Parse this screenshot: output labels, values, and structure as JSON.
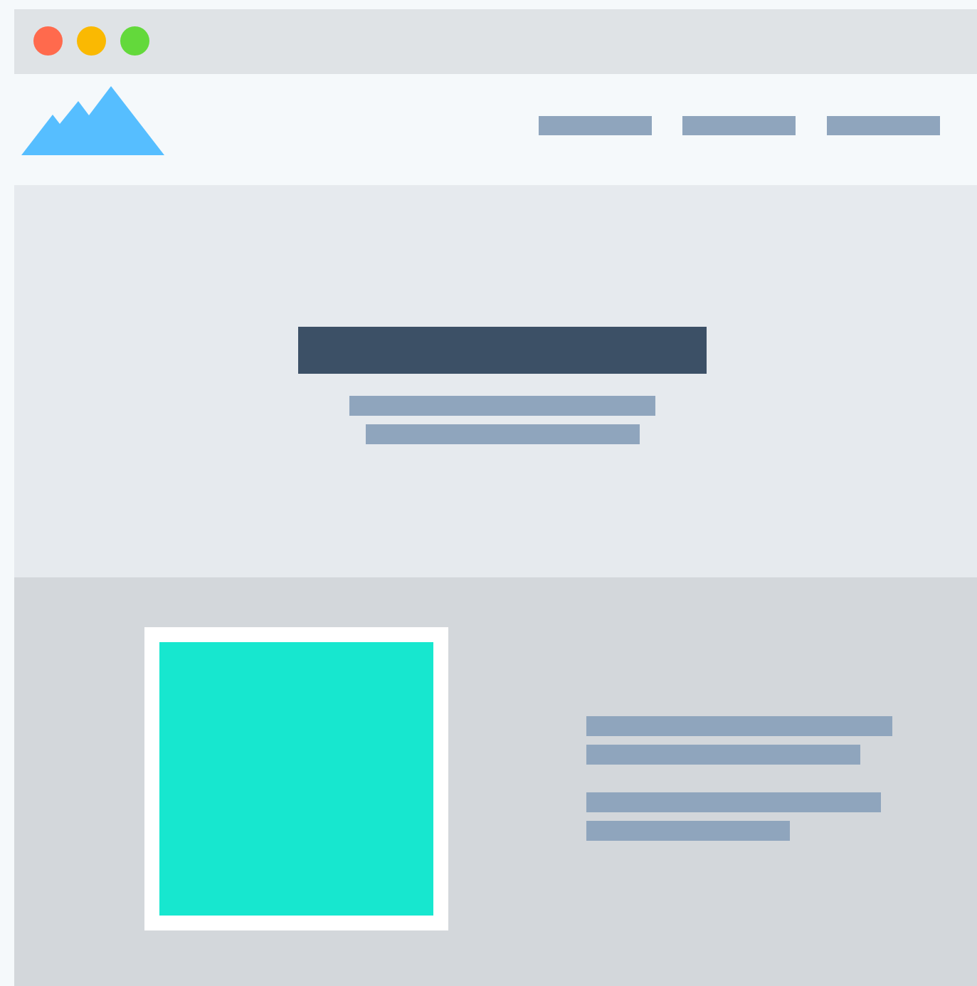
{
  "colors": {
    "page_background": "#F5F9FB",
    "titlebar": "#DFE3E6",
    "navbar": "#F5F9FB",
    "hero_background": "#E6EAEE",
    "feature_background": "#D3D7DB",
    "placeholder_line": "#8FA5BD",
    "hero_title_block": "#3C5066",
    "logo": "#56BEFF",
    "frame": "#FFFFFF",
    "feature_image": "#17E7CF",
    "dot_close": "#FF6A4D",
    "dot_minimize": "#FAB902",
    "dot_maximize": "#63D93B"
  },
  "window_controls": [
    "close",
    "minimize",
    "maximize"
  ],
  "logo": {
    "icon": "mountain-icon"
  },
  "navbar": {
    "links": [
      {
        "label": ""
      },
      {
        "label": ""
      },
      {
        "label": ""
      }
    ]
  },
  "hero": {
    "title": "",
    "subtitle_lines": [
      "",
      ""
    ]
  },
  "feature": {
    "image": {
      "icon": "image-placeholder"
    },
    "paragraphs": [
      [
        "",
        ""
      ],
      [
        "",
        ""
      ]
    ]
  }
}
